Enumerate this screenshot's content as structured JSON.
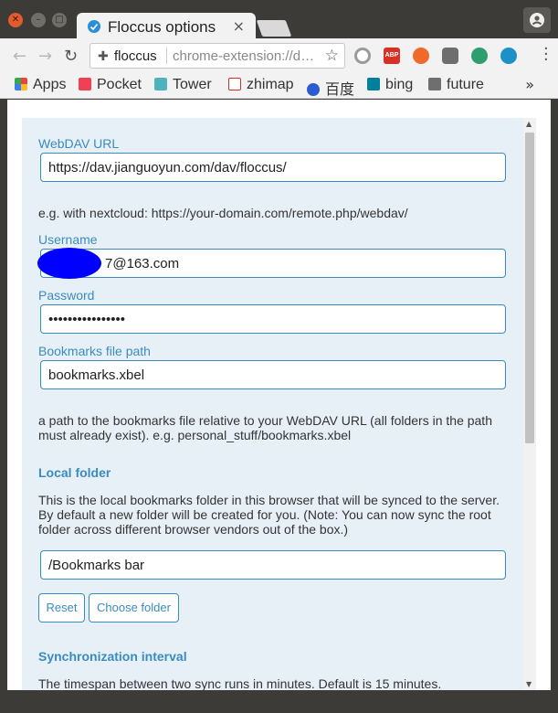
{
  "window": {
    "tab_title": "Floccus options",
    "tab_close": "×"
  },
  "toolbar": {
    "back": "←",
    "forward": "→",
    "reload": "↻",
    "site": "floccus",
    "url": "chrome-extension://d…",
    "star": "☆"
  },
  "bookmarks": {
    "items": [
      {
        "label": "Apps",
        "color": "#e8453c"
      },
      {
        "label": "Pocket",
        "color": "#ef4056"
      },
      {
        "label": "Tower",
        "color": "#4fb3bf"
      },
      {
        "label": "zhimap",
        "color": "#d93025"
      },
      {
        "label": "百度",
        "color": "#2d5bd3"
      },
      {
        "label": "bing",
        "color": "#00809d"
      },
      {
        "label": "future",
        "color": "#6f6f6f"
      }
    ],
    "more": "»"
  },
  "form": {
    "webdav_label": "WebDAV URL",
    "webdav_value": "https://dav.jianguoyun.com/dav/floccus/",
    "webdav_help": "e.g. with nextcloud: https://your-domain.com/remote.php/webdav/",
    "username_label": "Username",
    "username_value": "7@163.com",
    "password_label": "Password",
    "password_value": "••••••••••••••••",
    "path_label": "Bookmarks file path",
    "path_value": "bookmarks.xbel",
    "path_help": "a path to the bookmarks file relative to your WebDAV URL (all folders in the path must already exist). e.g. personal_stuff/bookmarks.xbel",
    "local_heading": "Local folder",
    "local_help": "This is the local bookmarks folder in this browser that will be synced to the server. By default a new folder will be created for you. (Note: You can now sync the root folder across different browser vendors out of the box.)",
    "local_value": "/Bookmarks bar",
    "reset_label": "Reset",
    "choose_label": "Choose folder",
    "sync_heading": "Synchronization interval",
    "sync_help": "The timespan between two sync runs in minutes. Default is 15 minutes."
  },
  "colors": {
    "accent": "#3a8bbf",
    "panel": "#e8f0f7",
    "redaction": "#0000ff"
  }
}
